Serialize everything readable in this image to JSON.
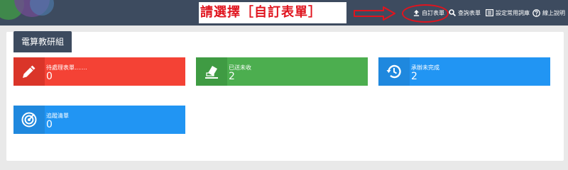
{
  "header": {
    "notice": "請選擇［自訂表單］",
    "nav": {
      "custom_form": "自訂表單",
      "query_form": "查詢表單",
      "common_terms": "設定常用詞庫",
      "online_help": "線上說明"
    }
  },
  "panel": {
    "title": "電算教研組",
    "cards": [
      {
        "label": "待處理表單.......",
        "value": "0",
        "icon": "pencil-icon"
      },
      {
        "label": "已送未收",
        "value": "2",
        "icon": "eraser-icon"
      },
      {
        "label": "承辦未完成",
        "value": "2",
        "icon": "history-icon"
      },
      {
        "label": "追蹤清單",
        "value": "0",
        "icon": "radar-icon"
      }
    ]
  },
  "colors": {
    "topbar": "#3d4b5f",
    "red": "#f44235",
    "green": "#4cae4f",
    "blue": "#2195f3",
    "highlight": "#e0141e"
  }
}
